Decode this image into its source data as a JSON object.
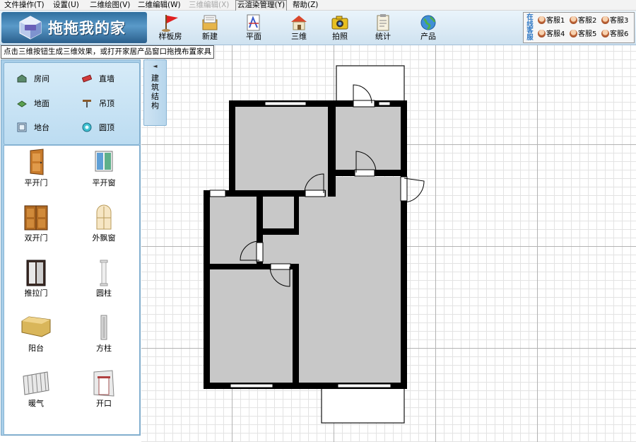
{
  "menu": {
    "items": [
      {
        "label": "文件操作(T)",
        "state": "normal"
      },
      {
        "label": "设置(U)",
        "state": "normal"
      },
      {
        "label": "二维绘图(V)",
        "state": "normal"
      },
      {
        "label": "二维编辑(W)",
        "state": "normal"
      },
      {
        "label": "三维编辑(X)",
        "state": "disabled"
      },
      {
        "label": "云渲染管理(Y)",
        "state": "active"
      },
      {
        "label": "帮助(Z)",
        "state": "normal"
      }
    ]
  },
  "logo": {
    "title": "拖拖我的家"
  },
  "toolbar": {
    "buttons": [
      {
        "label": "样板房",
        "icon": "flag-icon"
      },
      {
        "label": "新建",
        "icon": "new-document-icon"
      },
      {
        "label": "平面",
        "icon": "floor-plan-icon"
      },
      {
        "label": "三维",
        "icon": "house-3d-icon"
      },
      {
        "label": "拍照",
        "icon": "camera-icon"
      },
      {
        "label": "统计",
        "icon": "clipboard-icon"
      },
      {
        "label": "产品",
        "icon": "globe-icon"
      }
    ]
  },
  "service": {
    "tab_label": "在线客服",
    "agents": [
      "客服1",
      "客服2",
      "客服3",
      "客服4",
      "客服5",
      "客服6"
    ]
  },
  "hint": {
    "text": "点击三维按钮生成三维效果，或打开家居产品窗口拖拽布置家具"
  },
  "categories": [
    {
      "label": "房间",
      "icon": "room-icon"
    },
    {
      "label": "直墙",
      "icon": "straight-wall-icon"
    },
    {
      "label": "地面",
      "icon": "floor-icon"
    },
    {
      "label": "吊顶",
      "icon": "ceiling-icon"
    },
    {
      "label": "地台",
      "icon": "platform-icon"
    },
    {
      "label": "圆顶",
      "icon": "dome-icon"
    }
  ],
  "structure_tab": {
    "label": "建筑结构",
    "arrow": "◄"
  },
  "components": [
    {
      "label": "平开门",
      "icon": "single-door-icon"
    },
    {
      "label": "平开窗",
      "icon": "casement-window-icon"
    },
    {
      "label": "双开门",
      "icon": "double-door-icon"
    },
    {
      "label": "外飘窗",
      "icon": "bay-window-icon"
    },
    {
      "label": "推拉门",
      "icon": "sliding-door-icon"
    },
    {
      "label": "圆柱",
      "icon": "round-column-icon"
    },
    {
      "label": "阳台",
      "icon": "balcony-icon"
    },
    {
      "label": "方柱",
      "icon": "square-column-icon"
    },
    {
      "label": "暖气",
      "icon": "radiator-icon"
    },
    {
      "label": "开口",
      "icon": "opening-icon"
    }
  ],
  "colors": {
    "wall": "#000000",
    "floor": "#c8c8c8",
    "accent": "#2f78c5"
  }
}
